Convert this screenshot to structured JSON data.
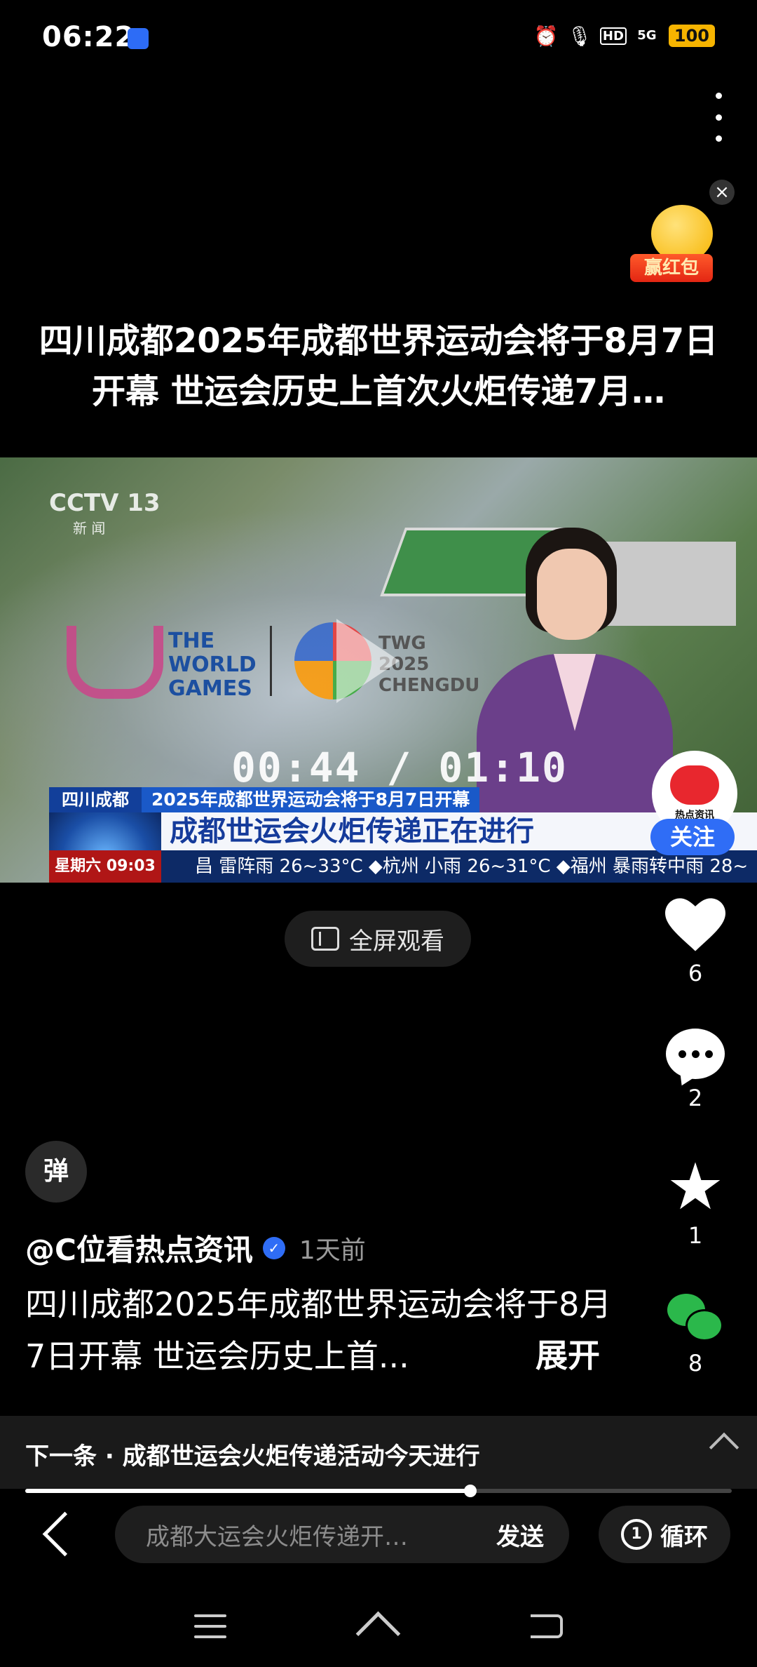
{
  "status_bar": {
    "time": "06:22",
    "network": "5G",
    "hd": "HD",
    "battery": "100",
    "icons": [
      "baidu-app-icon",
      "alarm-icon",
      "mic-icon",
      "hd-icon",
      "signal-icon",
      "battery-icon"
    ]
  },
  "promo": {
    "label": "赢红包"
  },
  "headline": "四川成都2025年成都世界运动会将于8月7日开幕 世运会历史上首次火炬传递7月…",
  "video": {
    "channel": "CCTV 13",
    "channel_sub": "新 闻",
    "wg_logo_text": "THE WORLD GAMES",
    "twg_text": "TWG 2025 CHENGDU",
    "time_display": "00:44 / 01:10",
    "current_time": "00:44",
    "duration": "01:10",
    "ticker_location": "四川成都",
    "ticker_subtitle": "2025年成都世界运动会将于8月7日开幕",
    "ticker_headline": "成都世运会火炬传递正在进行",
    "ticker_date": "星期六  09:03",
    "ticker_weather": "昌 雷阵雨 26~33°C   ◆杭州 小雨 26~31°C   ◆福州 暴雨转中雨 28~"
  },
  "follow": {
    "avatar_caption": "热点资讯",
    "button": "关注"
  },
  "fullscreen_label": "全屏观看",
  "rail": {
    "likes": "6",
    "comments": "2",
    "favorites": "1",
    "shares": "8"
  },
  "danmu_label": "弹",
  "author": {
    "name": "@C位看热点资讯",
    "time": "1天前"
  },
  "description": "四川成都2025年成都世界运动会将于8月7日开幕 世运会历史上首...",
  "expand_label": "展开",
  "next": {
    "text": "下一条 · 成都世运会火炬传递活动今天进行"
  },
  "progress": {
    "fraction": 0.63
  },
  "bottom": {
    "search_placeholder": "成都大运会火炬传递开…",
    "send": "发送",
    "loop_label": "循环",
    "loop_icon_digit": "1"
  },
  "colors": {
    "accent_blue": "#2f6df6",
    "wechat_green": "#2bb84b",
    "battery_yellow": "#f6b400"
  }
}
